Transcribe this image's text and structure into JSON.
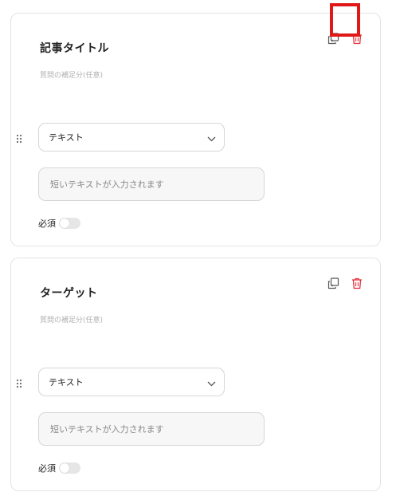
{
  "colors": {
    "delete_icon": "#e0323b",
    "copy_icon": "#555555",
    "highlight": "#e01818",
    "toggle_off": "#e6e6e6"
  },
  "questions": [
    {
      "title": "記事タイトル",
      "subtitle": "質問の補足分(任意)",
      "type_value": "テキスト",
      "answer_placeholder": "短いテキストが入力されます",
      "required_label": "必須",
      "required": false
    },
    {
      "title": "ターゲット",
      "subtitle": "質問の補足分(任意)",
      "type_value": "テキスト",
      "answer_placeholder": "短いテキストが入力されます",
      "required_label": "必須",
      "required": false
    }
  ],
  "icons": {
    "copy": "copy-icon",
    "delete": "trash-icon",
    "drag": "drag-handle-icon",
    "dropdown": "chevron-down-icon"
  }
}
